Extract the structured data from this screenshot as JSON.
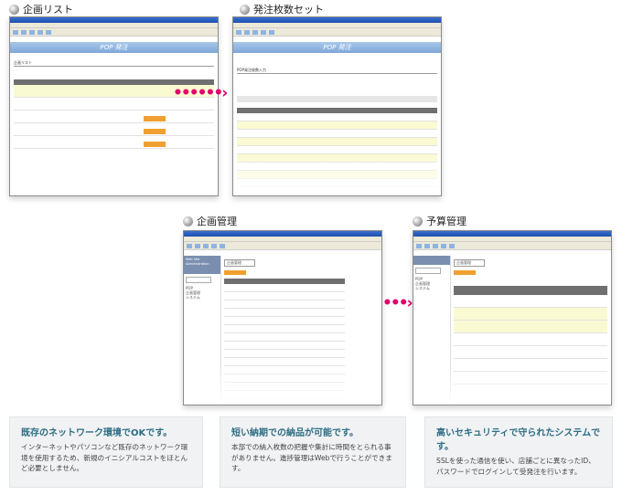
{
  "sections": {
    "plan_list": "企画リスト",
    "order_set": "発注枚数セット",
    "plan_mgmt": "企画管理",
    "budget_mgmt": "予算管理"
  },
  "screens": {
    "plan_list": {
      "logo": "POP 発注",
      "heading": "企画リスト"
    },
    "order_set": {
      "logo": "POP 発注",
      "heading": "POP発注枚数入力"
    },
    "plan_mgmt": {
      "sidebar_title": "Web Site Administration",
      "heading": "企画管理",
      "sidebar_items": [
        "POP",
        "企画管理",
        "システム"
      ]
    },
    "budget_mgmt": {
      "heading": "企画管理",
      "sidebar_items": [
        "POP",
        "企画管理",
        "システム"
      ]
    }
  },
  "features": [
    {
      "title": "既存のネットワーク環境でOKです。",
      "body": "インターネットやパソコンなど既存のネットワーク環境を使用するため、新規のイニシアルコストをほとんど必要としません。"
    },
    {
      "title": "短い納期での納品が可能です。",
      "body": "本部での納入枚数の把握や集計に時間をとられる事がありません。進捗管理はWebで行うことができます。"
    },
    {
      "title": "高いセキュリティで守られたシステムです。",
      "body": "SSLを使った通信を使い、店舗ごとに異なったID、パスワードでログインして受発注を行います。"
    }
  ],
  "colors": {
    "arrow": "#e0006a",
    "feature_title": "#2e6e84",
    "accent_orange": "#f0a030",
    "highlight_row": "#fafad2"
  }
}
